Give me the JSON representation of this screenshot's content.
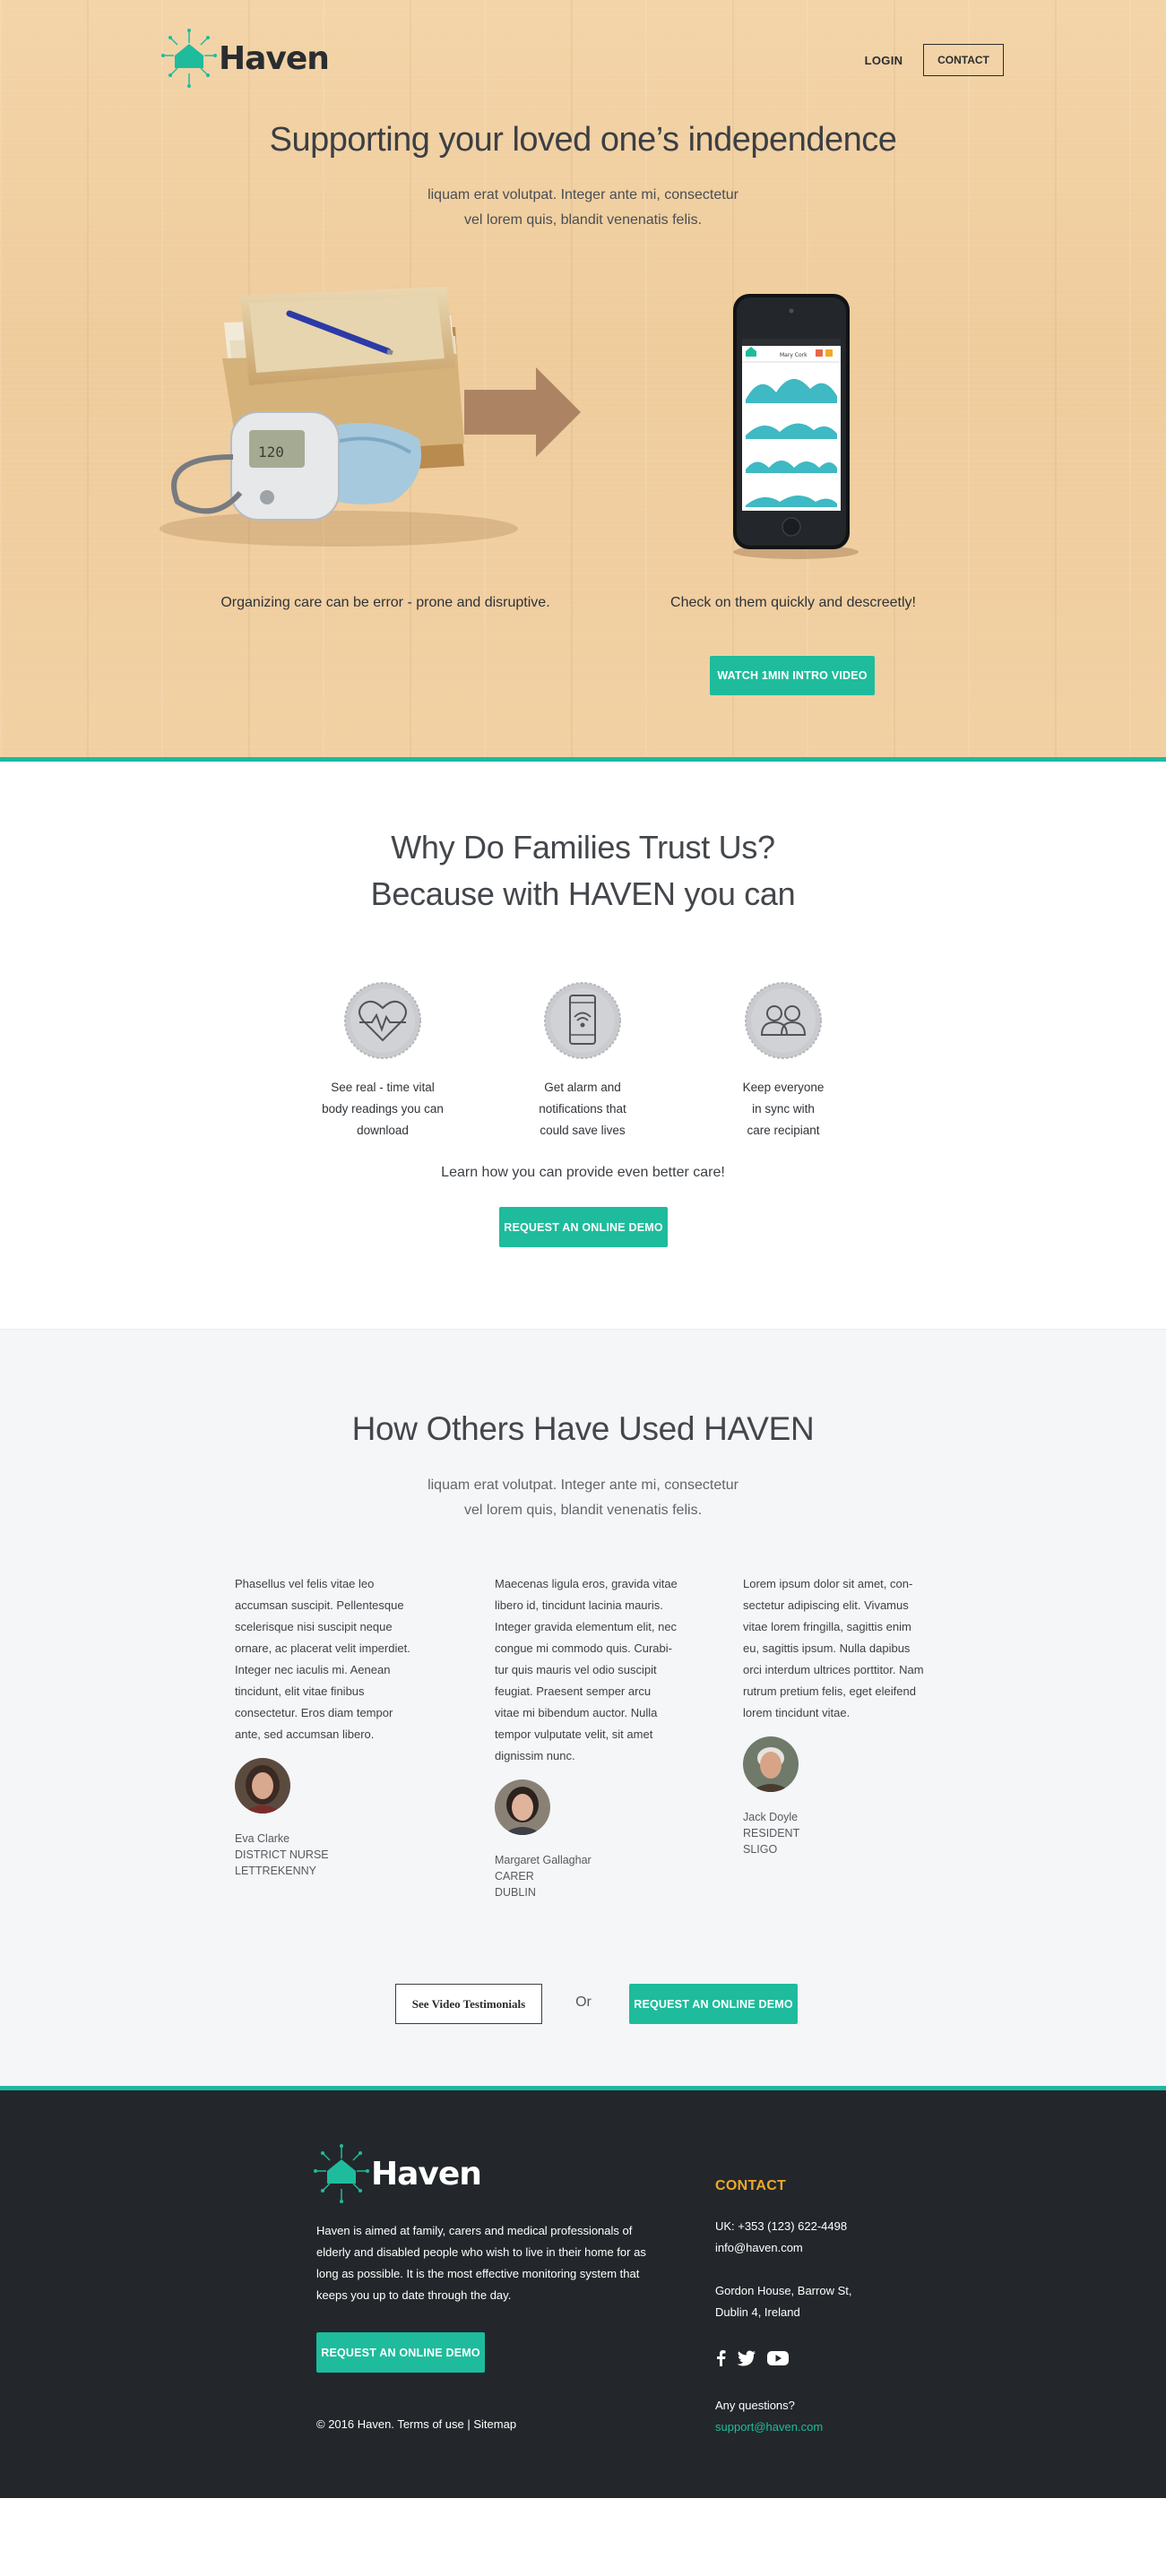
{
  "brand": {
    "name": "Haven",
    "color": "#1ebc9c"
  },
  "nav": {
    "login": "LOGIN",
    "contact": "CONTACT"
  },
  "hero": {
    "title": "Supporting your loved one’s independence",
    "lead_1": "liquam erat volutpat. Integer ante mi, consectetur",
    "lead_2": "vel lorem quis, blandit venenatis felis.",
    "caption_left": "Organizing care can be error - prone and disruptive.",
    "caption_right": "Check on them quickly and descreetly!",
    "watch_button": "WATCH 1MIN INTRO VIDEO",
    "phone_label": "Mary Cork"
  },
  "why": {
    "title_1": "Why Do Families Trust Us?",
    "title_2": "Because with HAVEN you can",
    "features": [
      {
        "icon": "heart-pulse-icon",
        "line_1": "See real - time vital",
        "line_2": "body readings you can",
        "line_3": "download"
      },
      {
        "icon": "phone-alarm-icon",
        "line_1": "Get alarm and",
        "line_2": "notifications that",
        "line_3": "could save lives"
      },
      {
        "icon": "people-icon",
        "line_1": "Keep everyone",
        "line_2": "in sync with",
        "line_3": "care recipiant"
      }
    ],
    "learn": "Learn how you can provide even better care!",
    "demo_button": "REQUEST AN ONLINE DEMO"
  },
  "testimonials": {
    "title": "How Others Have Used HAVEN",
    "lead_1": "liquam erat volutpat. Integer ante mi, consectetur",
    "lead_2": "vel lorem quis, blandit venenatis felis.",
    "items": [
      {
        "lines": [
          "Phasellus vel felis vitae leo",
          "accumsan suscipit. Pellentesque",
          "scelerisque nisi suscipit neque",
          "ornare, ac placerat velit imperdiet.",
          "Integer nec iaculis mi. Aenean",
          "tincidunt, elit vitae finibus",
          "consectetur. Eros diam tempor",
          "ante, sed accumsan libero."
        ],
        "name": "Eva Clarke",
        "role": "DISTRICT NURSE",
        "place": "LETTREKENNY"
      },
      {
        "lines": [
          "Maecenas ligula eros, gravida vitae",
          "libero id, tincidunt lacinia mauris.",
          "Integer gravida elementum elit, nec",
          "congue mi commodo quis. Curabi-",
          "tur quis mauris vel odio suscipit",
          "feugiat. Praesent semper arcu",
          "vitae mi bibendum auctor. Nulla",
          "tempor vulputate velit, sit amet",
          "dignissim nunc."
        ],
        "name": "Margaret Gallaghar",
        "role": "CARER",
        "place": "DUBLIN"
      },
      {
        "lines": [
          "Lorem ipsum dolor sit amet, con-",
          "sectetur adipiscing elit. Vivamus",
          "vitae lorem fringilla, sagittis enim",
          "eu, sagittis ipsum. Nulla dapibus",
          "orci interdum ultrices porttitor. Nam",
          "rutrum pretium felis, eget eleifend",
          "lorem tincidunt vitae."
        ],
        "name": "Jack Doyle",
        "role": "RESIDENT",
        "place": "SLIGO"
      }
    ],
    "video_button": "See Video Testimonials",
    "or": "Or",
    "demo_button": "REQUEST AN ONLINE DEMO"
  },
  "footer": {
    "about_lines": [
      "Haven is aimed at family, carers and medical professionals of",
      "elderly and disabled people who wish to live in their home for as",
      "long as possible. It is the most effective monitoring system that",
      "keeps you up to date  through the day."
    ],
    "demo_button": "REQUEST AN ONLINE DEMO",
    "copyright": "© 2016 Haven.",
    "terms": "Terms of use",
    "sep": "|",
    "sitemap": "Sitemap",
    "contact_title": "CONTACT",
    "phone": "UK: +353 (123) 622-4498",
    "email": "info@haven.com",
    "address_1": "Gordon House, Barrow St,",
    "address_2": "Dublin 4, Ireland",
    "social": [
      "facebook-icon",
      "twitter-icon",
      "youtube-icon"
    ],
    "questions": "Any questions?",
    "support": "support@haven.com",
    "accent": "#f0a82a"
  }
}
